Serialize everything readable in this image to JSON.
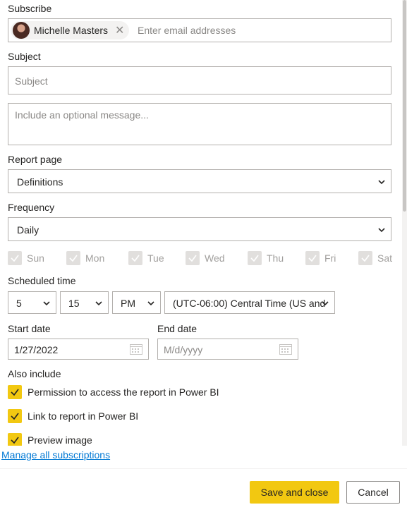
{
  "subscribe": {
    "label": "Subscribe",
    "recipient": "Michelle Masters",
    "email_placeholder": "Enter email addresses"
  },
  "subject": {
    "label": "Subject",
    "placeholder": "Subject"
  },
  "message": {
    "placeholder": "Include an optional message..."
  },
  "report_page": {
    "label": "Report page",
    "value": "Definitions"
  },
  "frequency": {
    "label": "Frequency",
    "value": "Daily"
  },
  "days": [
    "Sun",
    "Mon",
    "Tue",
    "Wed",
    "Thu",
    "Fri",
    "Sat"
  ],
  "scheduled_time": {
    "label": "Scheduled time",
    "hour": "5",
    "minute": "15",
    "ampm": "PM",
    "timezone": "(UTC-06:00) Central Time (US and"
  },
  "start_date": {
    "label": "Start date",
    "value": "1/27/2022"
  },
  "end_date": {
    "label": "End date",
    "placeholder": "M/d/yyyy"
  },
  "also_include": {
    "label": "Also include",
    "options": [
      "Permission to access the report in Power BI",
      "Link to report in Power BI",
      "Preview image"
    ]
  },
  "manage_link": "Manage all subscriptions",
  "buttons": {
    "save": "Save and close",
    "cancel": "Cancel"
  },
  "colors": {
    "accent": "#f2c811",
    "link": "#0078d4",
    "border": "#b3b0ad"
  }
}
